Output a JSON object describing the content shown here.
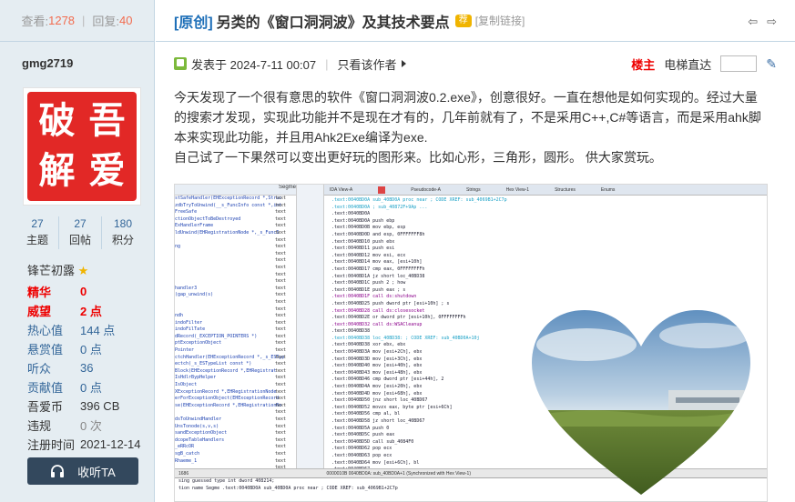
{
  "thread_stats": {
    "views_label": "查看:",
    "views": "1278",
    "replies_label": "回复:",
    "replies": "40"
  },
  "author": {
    "name": "gmg2719",
    "avatar_chars": [
      "吾",
      "破",
      "爱",
      "解"
    ],
    "counters": [
      {
        "value": "27",
        "label": "主题"
      },
      {
        "value": "27",
        "label": "回帖"
      },
      {
        "value": "180",
        "label": "积分"
      }
    ],
    "group": "锋芒初露",
    "profile": [
      {
        "key": "精华",
        "value": "0",
        "style": "red"
      },
      {
        "key": "威望",
        "value": "2 点",
        "style": "red"
      },
      {
        "key": "热心值",
        "value": "144 点",
        "style": "blue"
      },
      {
        "key": "悬赏值",
        "value": "0 点",
        "style": "blue"
      },
      {
        "key": "听众",
        "value": "36",
        "style": "blue"
      },
      {
        "key": "贡献值",
        "value": "0 点",
        "style": "blue"
      },
      {
        "key": "吾爱币",
        "value": "396 CB",
        "style": "plain"
      },
      {
        "key": "违规",
        "value": "0 次",
        "style": "gray"
      },
      {
        "key": "注册时间",
        "value": "2021-12-14",
        "style": "plain"
      }
    ],
    "listen_button": "收听TA"
  },
  "post": {
    "tag": "[原创]",
    "title": "另类的《窗口洞洞波》及其技术要点",
    "badge": "荐",
    "copy_link": "[复制链接]",
    "posted_label": "发表于 2024-7-11 00:07",
    "author_only": "只看该作者",
    "floor_label": "楼主",
    "elevator_label": "电梯直达",
    "paragraphs": [
      "今天发现了一个很有意思的软件《窗口洞洞波0.2.exe》，创意很好。一直在想他是如何实现的。经过大量的搜索才发现，实现此功能并不是现在才有的，几年前就有了，不是采用C++,C#等语言，而是采用ahk脚本来实现此功能，并且用Ahk2Exe编译为exe.",
      "自己试了一下果然可以变出更好玩的图形来。比如心形，三角形，圆形。 供大家赏玩。"
    ]
  },
  "screenshot": {
    "left_header": "Segme",
    "left_lines": [
      "stSafeHandler(EHExceptionRecord *,Struc",
      "zdbTryToUnwind(__s_FuncInfo const *,int",
      "FreeSafe",
      "ctionObjectToBeDestroyed",
      "ExHandlerFrame",
      "ldUnwind(EHRegistrationNode *,_s_FuncI",
      "",
      "ng",
      "",
      "",
      "",
      "",
      "",
      "handler3",
      "(gap_unwind(s)",
      "",
      "",
      "ndh",
      "indoFilter",
      "indoFilTate",
      "dRecord(_EXCEPTION_POINTERS *)",
      "ptExceptionObject",
      "Pointer",
      "ctchHandler(EHExceptionRecord *,_s_ESTyp",
      "ectch(_s_ESTypeList const *)",
      "Block(EHExceptionRecord *,EHRegistrat",
      "IsHdlrBypHelper",
      "IsObject",
      "XExceptionRecord *,EHRegistrationNode",
      "erForExceptionObject(EHExceptionRecord",
      "se(EHExceptionRecord *,EHRegistrationNo",
      "",
      "dsToUnwindHandler",
      "UnsTonode(s,v,s)",
      "sandExceptionObject",
      "dcopeTableHandlers",
      "_eRRcOR",
      "sgB_catch",
      "Rhaeme_1",
      "",
      "",
      "",
      "",
      "",
      "",
      "",
      ""
    ],
    "left_seg_lines": [
      "text",
      "text",
      "text",
      "text",
      "text",
      "text",
      "text",
      "text",
      "text",
      "text",
      "text",
      "text",
      "text",
      "text",
      "text",
      "text",
      "text",
      "text",
      "text",
      "text",
      "text",
      "text",
      "text",
      "text",
      "text",
      "text",
      "text",
      "text",
      "text",
      "text",
      "text",
      "text",
      "text",
      "text",
      "text",
      "text",
      "text",
      "text",
      "text",
      "text",
      "text",
      "text",
      "text",
      "text"
    ],
    "tabs": [
      "IDA View-A",
      "Pseudocode-A",
      "Strings",
      "Hex View-1",
      "Structures",
      "Enums"
    ],
    "code_lines": [
      {
        "t": ".text:0040BD0A sub_40BD0A      proc near               ; CODE XREF: sub_4069B1+2C7p",
        "k": "c"
      },
      {
        "t": ".text:0040BD0A                                         ; sub_40872F+9Ap ...",
        "k": "c"
      },
      {
        "t": ".text:0040BD0A",
        "k": ""
      },
      {
        "t": ".text:0040BD0A                 push    ebp",
        "k": ""
      },
      {
        "t": ".text:0040BD0B                 mov     ebp, esp",
        "k": ""
      },
      {
        "t": ".text:0040BD0D                 and     esp, 0FFFFFFF8h",
        "k": ""
      },
      {
        "t": ".text:0040BD10                 push    ebx",
        "k": ""
      },
      {
        "t": ".text:0040BD11                 push    esi",
        "k": ""
      },
      {
        "t": ".text:0040BD12                 mov     esi, ecx",
        "k": ""
      },
      {
        "t": ".text:0040BD14                 mov     eax, [esi+10h]",
        "k": ""
      },
      {
        "t": ".text:0040BD17                 cmp     eax, 0FFFFFFFFh",
        "k": ""
      },
      {
        "t": ".text:0040BD1A                 jz      short loc_40BD38",
        "k": ""
      },
      {
        "t": ".text:0040BD1C                 push    2               ; how",
        "k": ""
      },
      {
        "t": ".text:0040BD1E                 push    eax             ; s",
        "k": ""
      },
      {
        "t": ".text:0040BD1F                 call    ds:shutdown",
        "k": "s"
      },
      {
        "t": ".text:0040BD25                 push    dword ptr [esi+10h] ; s",
        "k": ""
      },
      {
        "t": ".text:0040BD28                 call    ds:closesocket",
        "k": "s"
      },
      {
        "t": ".text:0040BD2E                 or      dword ptr [esi+10h], 0FFFFFFFFh",
        "k": ""
      },
      {
        "t": ".text:0040BD32                 call    ds:WSACleanup",
        "k": "s"
      },
      {
        "t": ".text:0040BD38",
        "k": ""
      },
      {
        "t": ".text:0040BD38 loc_40BD38:                             ; CODE XREF: sub_40BD0A+10j",
        "k": "c"
      },
      {
        "t": ".text:0040BD38                 xor     ebx, ebx",
        "k": ""
      },
      {
        "t": ".text:0040BD3A                 mov     [esi+2Ch], ebx",
        "k": ""
      },
      {
        "t": ".text:0040BD3D                 mov     [esi+3Ch], ebx",
        "k": ""
      },
      {
        "t": ".text:0040BD40                 mov     [esi+40h], ebx",
        "k": ""
      },
      {
        "t": ".text:0040BD43                 mov     [esi+48h], ebx",
        "k": ""
      },
      {
        "t": ".text:0040BD46                 cmp     dword ptr [esi+44h], 2",
        "k": ""
      },
      {
        "t": ".text:0040BD4A                 mov     [esi+20h], ebx",
        "k": ""
      },
      {
        "t": ".text:0040BD4D                 mov     [esi+68h], ebx",
        "k": ""
      },
      {
        "t": ".text:0040BD50                 jnz     short loc_40BD67",
        "k": ""
      },
      {
        "t": ".text:0040BD52                 movzx   eax, byte ptr [esi+6Ch]",
        "k": ""
      },
      {
        "t": ".text:0040BD56                 cmp     al, bl",
        "k": ""
      },
      {
        "t": ".text:0040BD58                 jz      short loc_40BD67",
        "k": ""
      },
      {
        "t": ".text:0040BD5A                 push    0",
        "k": ""
      },
      {
        "t": ".text:0040BD5C                 push    eax",
        "k": ""
      },
      {
        "t": ".text:0040BD5D                 call    sub_4084F0",
        "k": ""
      },
      {
        "t": ".text:0040BD62                 pop     ecx",
        "k": ""
      },
      {
        "t": ".text:0040BD63                 pop     ecx",
        "k": ""
      },
      {
        "t": ".text:0040BD64                 mov     [esi+6Ch], bl",
        "k": ""
      },
      {
        "t": ".text:0040BD67",
        "k": ""
      },
      {
        "t": ".text:0040BD67 loc_40BD67:                             ; CODE XREF: sub_40BD0A+46j",
        "k": "c"
      },
      {
        "t": ".text:0040BD67                                         ; sub_40BD0A+4Ej",
        "k": "c"
      },
      {
        "t": ".text:0040BD67                 mov     [esi+44h], ebx",
        "k": ""
      },
      {
        "t": ".text:0040BD6A                 pop     esi",
        "k": ""
      }
    ],
    "status": "0000010B 0040BD0A: sub_40BD0A+1 (Synchronized with Hex View-1)",
    "left_status": "1686",
    "bottom_lines": [
      "sing guessed type int dword 408214;",
      "tion name                         Segme .text:0040BD0A sub_40BD0A      proc near    ; CODE XREF: sub_4069B1+2C7p"
    ]
  },
  "colors": {
    "accent_blue": "#1e6fb8",
    "red": "#e22826",
    "sidebar_bg": "#e5edf2",
    "button_dark": "#33485d"
  }
}
